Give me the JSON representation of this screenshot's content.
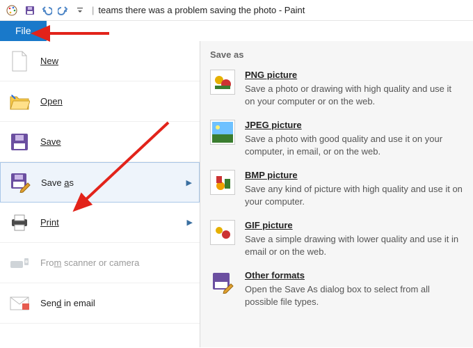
{
  "titlebar": {
    "title": "teams there was a problem saving the photo - Paint"
  },
  "fileTab": {
    "label": "File"
  },
  "menu": {
    "new": "New",
    "open": "Open",
    "save": "Save",
    "saveAs": "Save as",
    "print": "Print",
    "scanner": "From scanner or camera",
    "sendEmail": "Send in email"
  },
  "rightPanel": {
    "header": "Save as",
    "formats": [
      {
        "title": "PNG picture",
        "desc": "Save a photo or drawing with high quality and use it on your computer or on the web."
      },
      {
        "title": "JPEG picture",
        "desc": "Save a photo with good quality and use it on your computer, in email, or on the web."
      },
      {
        "title": "BMP picture",
        "desc": "Save any kind of picture with high quality and use it on your computer."
      },
      {
        "title": "GIF picture",
        "desc": "Save a simple drawing with lower quality and use it in email or on the web."
      },
      {
        "title": "Other formats",
        "desc": "Open the Save As dialog box to select from all possible file types."
      }
    ]
  }
}
